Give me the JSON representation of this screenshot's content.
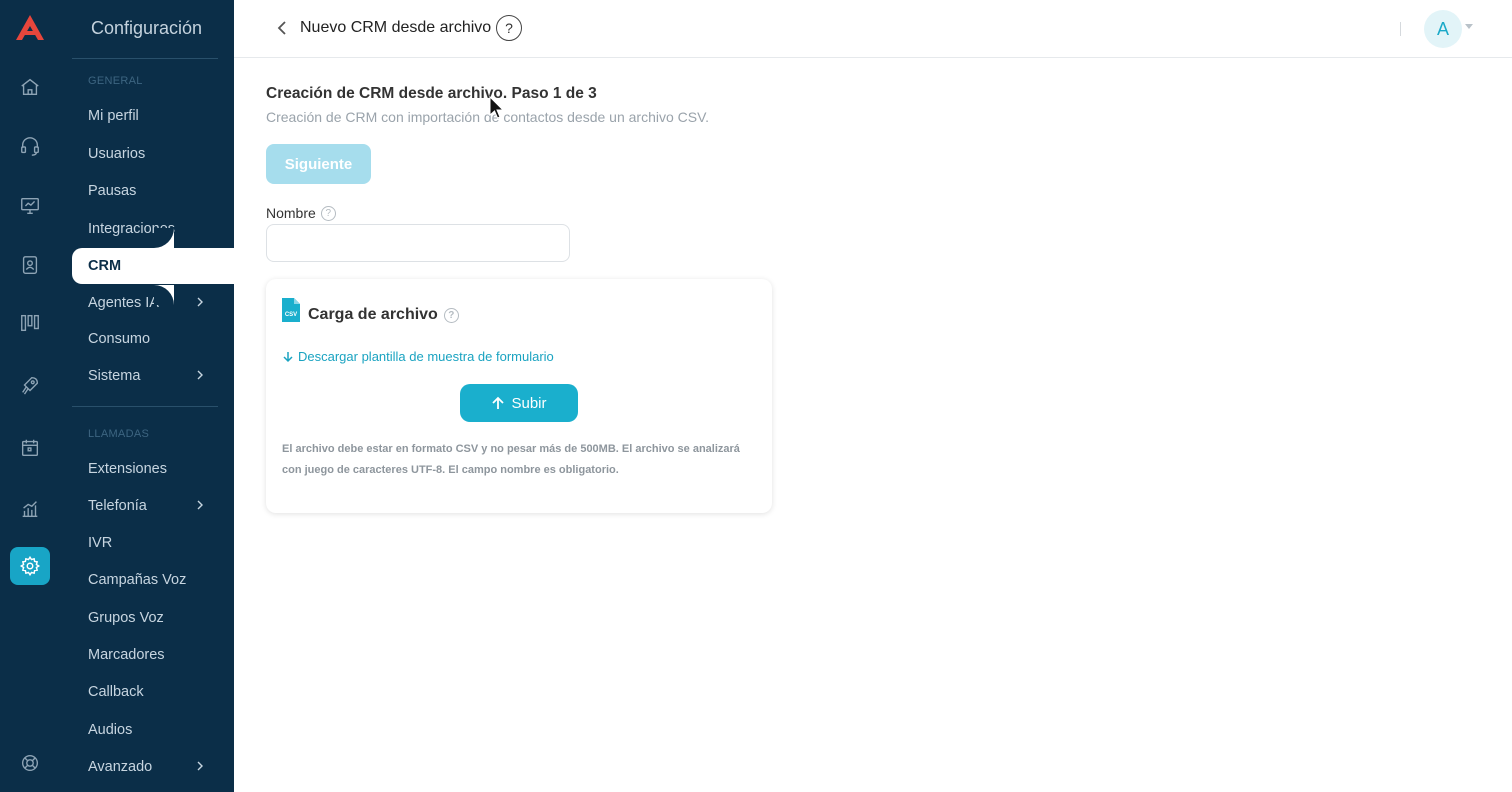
{
  "sidebar": {
    "title": "Configuración",
    "sections": {
      "general": "GENERAL",
      "llamadas": "LLAMADAS"
    },
    "items": [
      {
        "label": "Mi perfil"
      },
      {
        "label": "Usuarios"
      },
      {
        "label": "Pausas"
      },
      {
        "label": "Integraciones"
      },
      {
        "label": "CRM"
      },
      {
        "label": "Agentes IA"
      },
      {
        "label": "Consumo"
      },
      {
        "label": "Sistema"
      },
      {
        "label": "Extensiones"
      },
      {
        "label": "Telefonía"
      },
      {
        "label": "IVR"
      },
      {
        "label": "Campañas Voz"
      },
      {
        "label": "Grupos Voz"
      },
      {
        "label": "Marcadores"
      },
      {
        "label": "Callback"
      },
      {
        "label": "Audios"
      },
      {
        "label": "Avanzado"
      }
    ],
    "active_item": "CRM"
  },
  "rail": {
    "icons": [
      "logo-icon",
      "home-icon",
      "headset-icon",
      "monitor-icon",
      "contacts-icon",
      "kanban-icon",
      "rocket-icon",
      "calendar-icon",
      "stats-icon",
      "gear-icon",
      "support-icon"
    ],
    "active": "gear-icon"
  },
  "header": {
    "title": "Nuevo CRM desde archivo",
    "help": "?",
    "avatar_initial": "A"
  },
  "main": {
    "step_title": "Creación de CRM desde archivo. Paso 1 de 3",
    "step_subtitle": "Creación de CRM con importación de contactos desde un archivo CSV.",
    "next_label": "Siguiente",
    "name_label": "Nombre",
    "name_value": "",
    "card": {
      "title": "Carga de archivo",
      "download_link": "Descargar plantilla de muestra de formulario",
      "upload_label": "Subir",
      "note": "El archivo debe estar en formato CSV y no pesar más de 500MB. El archivo se analizará con juego de caracteres UTF-8. El campo nombre es obligatorio.",
      "csv_badge": "CSV"
    }
  },
  "colors": {
    "sidebar_bg": "#0b2e48",
    "accent": "#1aafcd",
    "disabled_button": "#a6dded"
  }
}
